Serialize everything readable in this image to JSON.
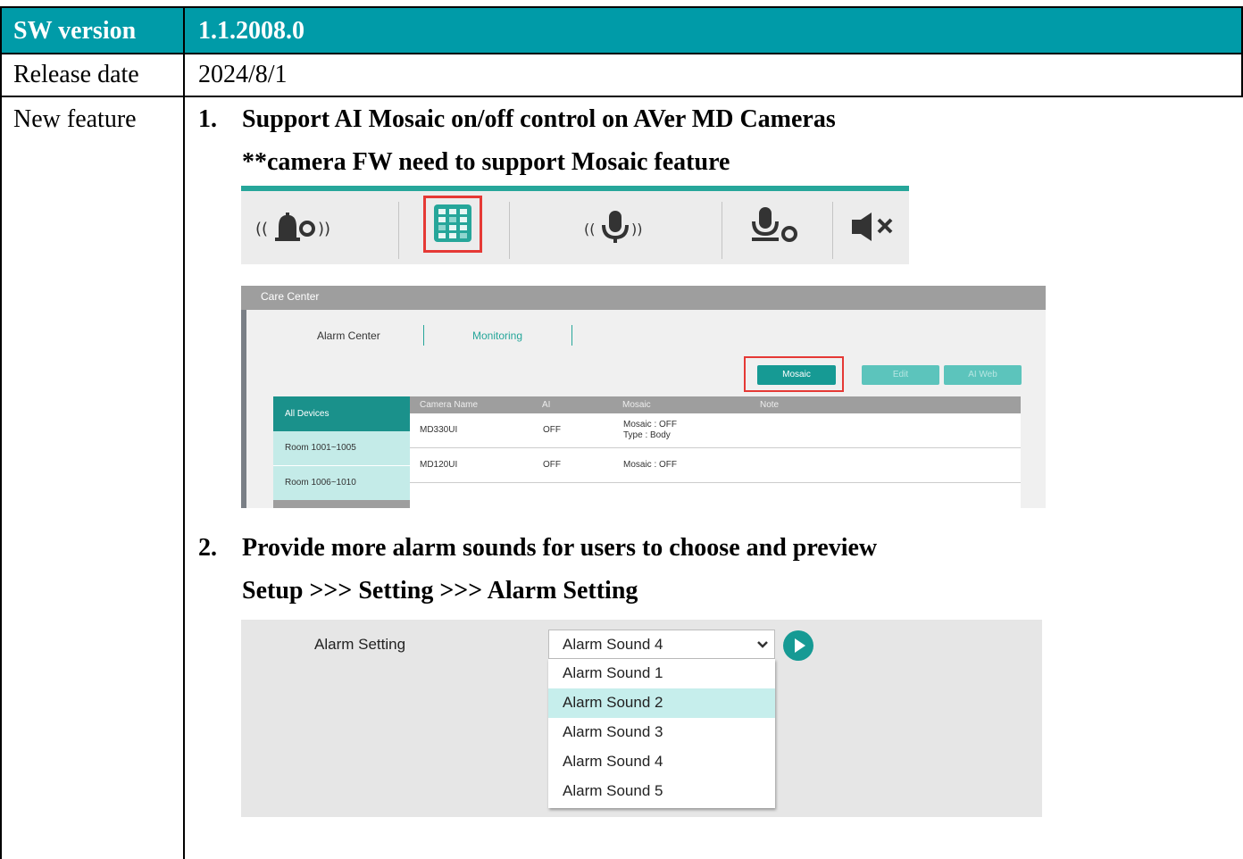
{
  "table": {
    "sw_version_label": "SW version",
    "sw_version_value": "1.1.2008.0",
    "release_date_label": "Release date",
    "release_date_value": "2024/8/1",
    "new_feature_label": "New feature"
  },
  "features": [
    {
      "number": "1.",
      "title": "Support AI Mosaic on/off control on AVer MD Cameras",
      "subtitle": "**camera FW need to support Mosaic feature"
    },
    {
      "number": "2.",
      "title": "Provide more alarm sounds for users to choose and preview",
      "subtitle": "Setup >>> Setting >>> Alarm Setting"
    }
  ],
  "toolbar": {
    "icons": [
      "alarm-settings-icon",
      "mosaic-grid-icon",
      "microphone-broadcast-icon",
      "microphone-settings-icon",
      "speaker-mute-icon"
    ],
    "accent_color": "#26a69a",
    "highlight_color": "#e53935"
  },
  "care_center": {
    "title": "Care Center",
    "tabs": [
      "Alarm Center",
      "Monitoring"
    ],
    "buttons": {
      "mosaic": "Mosaic",
      "edit": "Edit",
      "ai_web": "AI Web"
    },
    "groups": [
      "All Devices",
      "Room 1001~1005",
      "Room 1006~1010"
    ],
    "columns": [
      "Camera Name",
      "AI",
      "Mosaic",
      "Note"
    ],
    "rows": [
      {
        "name": "MD330UI",
        "ai": "OFF",
        "mosaic": "Mosaic : OFF",
        "type": "Type : Body"
      },
      {
        "name": "MD120UI",
        "ai": "OFF",
        "mosaic": "Mosaic : OFF",
        "type": ""
      }
    ]
  },
  "alarm_setting": {
    "label": "Alarm Setting",
    "selected": "Alarm Sound 4",
    "options": [
      "Alarm Sound 1",
      "Alarm Sound 2",
      "Alarm Sound 3",
      "Alarm Sound 4",
      "Alarm Sound 5"
    ],
    "hovered_option": "Alarm Sound 2"
  }
}
